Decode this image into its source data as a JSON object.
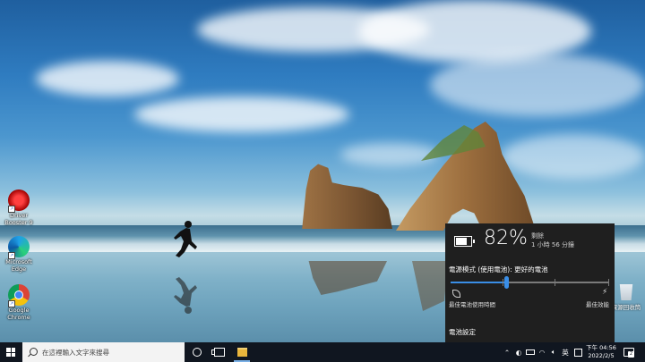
{
  "desktop": {
    "icons": [
      {
        "label": "Driver Booster 9",
        "icon": "driver-booster-icon"
      },
      {
        "label": "Microsoft Edge",
        "icon": "edge-icon"
      },
      {
        "label": "Google Chrome",
        "icon": "chrome-icon"
      }
    ],
    "recycle_bin": {
      "label": "資源回收筒",
      "icon": "recycle-bin-icon"
    }
  },
  "battery_flyout": {
    "percent": "82%",
    "remaining_label": "剩餘",
    "remaining_value": "1 小時 56 分鐘",
    "power_mode": "電源模式 (使用電池): 更好的電池",
    "slider_value": 0.35,
    "left_label": "最佳電池使用時間",
    "right_label": "最佳效能",
    "settings_link": "電池設定"
  },
  "taskbar": {
    "search_placeholder": "在這裡輸入文字來搜尋",
    "tray": {
      "ime": "英",
      "notification_count": "2"
    },
    "clock": {
      "time": "下午 04:56",
      "date": "2022/2/5"
    }
  },
  "colors": {
    "taskbar_bg": "#101620",
    "flyout_bg": "#1f1f1f",
    "accent": "#3a8ee6"
  }
}
